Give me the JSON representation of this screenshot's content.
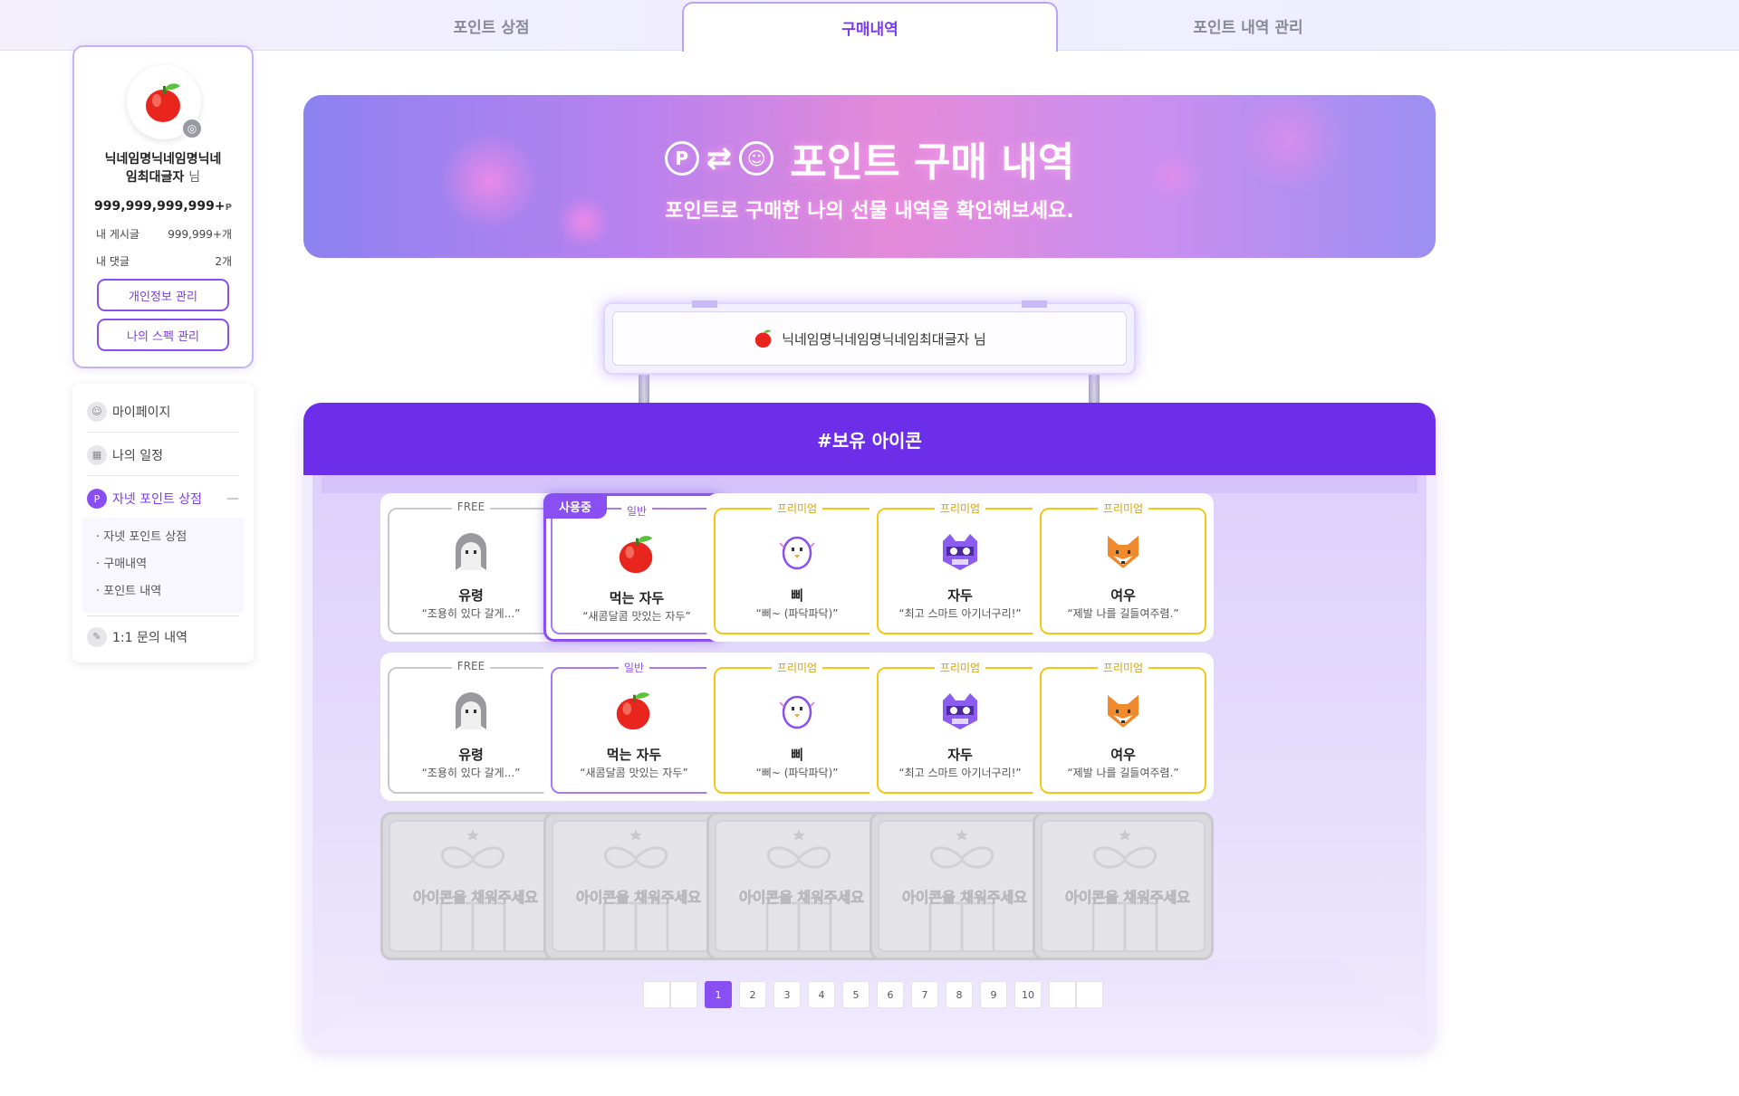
{
  "tabs": [
    {
      "label": "포인트 상점"
    },
    {
      "label": "구매내역"
    },
    {
      "label": "포인트 내역 관리"
    }
  ],
  "profile": {
    "nickname_line1": "닉네임명닉네임명닉네",
    "nickname_line2": "임최대글자",
    "suffix": "님",
    "points": "999,999,999,999+",
    "points_unit": "P",
    "posts_label": "내 게시글",
    "posts_value": "999,999+개",
    "comments_label": "내 댓글",
    "comments_value": "2개",
    "btn_profile": "개인정보 관리",
    "btn_spec": "나의 스펙 관리"
  },
  "menu": {
    "mypage": "마이페이지",
    "schedule": "나의 일정",
    "shop": "자넷 포인트 상점",
    "shop_toggle": "—",
    "sub": [
      "· 자넷 포인트 상점",
      "· 구매내역",
      "· 포인트 내역"
    ],
    "inquiry": "1:1 문의 내역"
  },
  "banner": {
    "title": "포인트 구매 내역",
    "subtitle": "포인트로 구매한 나의 선물 내역을 확인해보세요."
  },
  "sign": {
    "name": "닉네임명닉네임명닉네임최대글자 님"
  },
  "showcase": {
    "title": "#보유 아이콘",
    "using_label": "사용중",
    "empty_label": "아이콘을 채워주세요",
    "cards": [
      {
        "tier": "FREE",
        "name": "유령",
        "desc": "“조용히 있다 갈게...”",
        "icon": "ghost-icon"
      },
      {
        "tier": "일반",
        "name": "먹는 자두",
        "desc": "“새콤달콤 맛있는 자두”",
        "icon": "plum-icon"
      },
      {
        "tier": "프리미엄",
        "name": "삐",
        "desc": "“삐~ (파닥파닥)”",
        "icon": "chick-icon"
      },
      {
        "tier": "프리미엄",
        "name": "자두",
        "desc": "“최고 스마트 아기너구리!”",
        "icon": "raccoon-icon"
      },
      {
        "tier": "프리미엄",
        "name": "여우",
        "desc": "“제발 나를 길들여주렴.”",
        "icon": "fox-icon"
      },
      {
        "tier": "FREE",
        "name": "유령",
        "desc": "“조용히 있다 갈게...”",
        "icon": "ghost-icon"
      },
      {
        "tier": "일반",
        "name": "먹는 자두",
        "desc": "“새콤달콤 맛있는 자두”",
        "icon": "plum-icon"
      },
      {
        "tier": "프리미엄",
        "name": "삐",
        "desc": "“삐~ (파닥파닥)”",
        "icon": "chick-icon"
      },
      {
        "tier": "프리미엄",
        "name": "자두",
        "desc": "“최고 스마트 아기너구리!”",
        "icon": "raccoon-icon"
      },
      {
        "tier": "프리미엄",
        "name": "여우",
        "desc": "“제발 나를 길들여주렴.”",
        "icon": "fox-icon"
      }
    ]
  },
  "pagination": {
    "pages": [
      "1",
      "2",
      "3",
      "4",
      "5",
      "6",
      "7",
      "8",
      "9",
      "10"
    ],
    "current": "1"
  },
  "colors": {
    "accent": "#8a4ff2",
    "header": "#6c2ee8",
    "premium": "#f2c717"
  }
}
